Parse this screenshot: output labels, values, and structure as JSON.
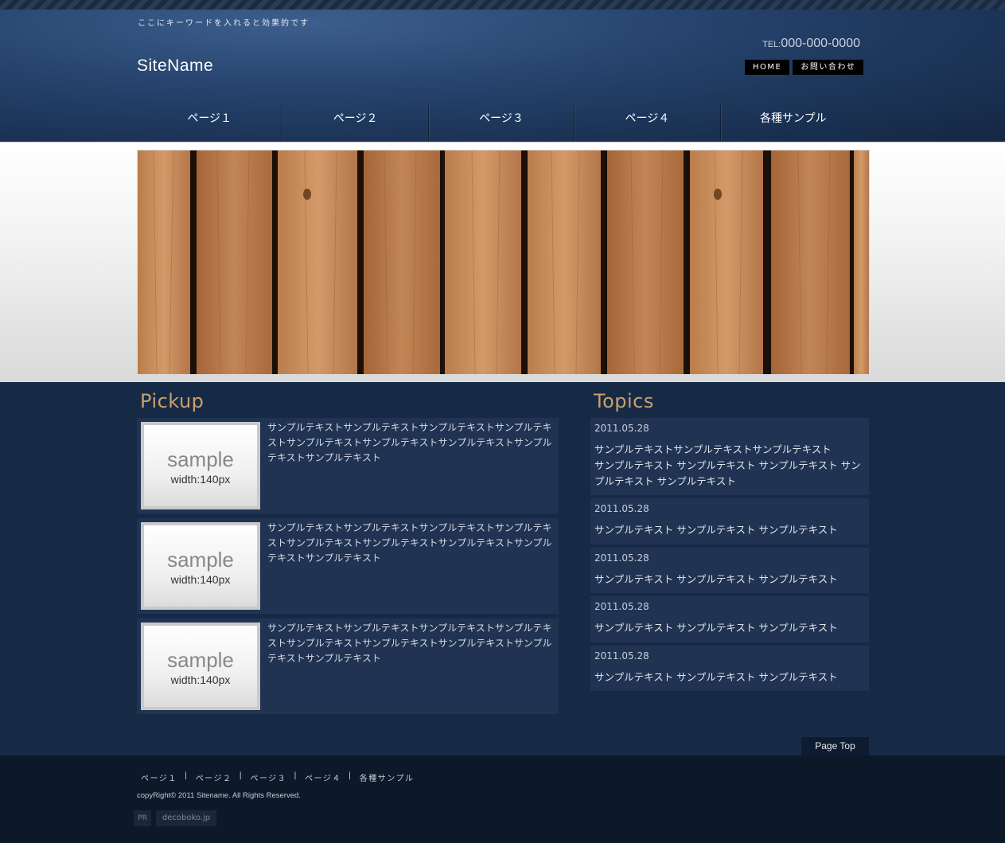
{
  "header": {
    "keyword": "ここにキーワードを入れると効果的です",
    "site_name": "SiteName",
    "tel_label": "TEL:",
    "tel_number": "000-000-0000",
    "home_button": "HOME",
    "contact_button": "お問い合わせ"
  },
  "nav": [
    "ページ１",
    "ページ２",
    "ページ３",
    "ページ４",
    "各種サンプル"
  ],
  "pickup": {
    "title": "Pickup",
    "items": [
      {
        "thumb_word": "sample",
        "thumb_size": "width:140px",
        "text": "サンプルテキストサンプルテキストサンプルテキストサンプルテキストサンプルテキストサンプルテキストサンプルテキストサンプルテキストサンプルテキスト"
      },
      {
        "thumb_word": "sample",
        "thumb_size": "width:140px",
        "text": "サンプルテキストサンプルテキストサンプルテキストサンプルテキストサンプルテキストサンプルテキストサンプルテキストサンプルテキストサンプルテキスト"
      },
      {
        "thumb_word": "sample",
        "thumb_size": "width:140px",
        "text": "サンプルテキストサンプルテキストサンプルテキストサンプルテキストサンプルテキストサンプルテキストサンプルテキストサンプルテキストサンプルテキスト"
      }
    ]
  },
  "topics": {
    "title": "Topics",
    "items": [
      {
        "date": "2011.05.28",
        "line1": "サンプルテキストサンプルテキストサンプルテキスト",
        "line2": "サンプルテキスト サンプルテキスト サンプルテキスト サンプルテキスト サンプルテキスト"
      },
      {
        "date": "2011.05.28",
        "line1": "サンプルテキスト サンプルテキスト サンプルテキスト",
        "line2": ""
      },
      {
        "date": "2011.05.28",
        "line1": "サンプルテキスト サンプルテキスト サンプルテキスト",
        "line2": ""
      },
      {
        "date": "2011.05.28",
        "line1": "サンプルテキスト サンプルテキスト サンプルテキスト",
        "line2": ""
      },
      {
        "date": "2011.05.28",
        "line1": "サンプルテキスト サンプルテキスト サンプルテキスト",
        "line2": ""
      }
    ]
  },
  "page_top": "Page Top",
  "footer": {
    "nav": [
      "ページ１",
      "ページ２",
      "ページ３",
      "ページ４",
      "各種サンプル"
    ],
    "separator": "|",
    "copyright": "copyRight© 2011 Sitename. All Rights Reserved.",
    "pr": "PR",
    "decoboko": "decoboko.jp"
  },
  "colors": {
    "background": "#172a45",
    "header": "#284671",
    "panel": "#203352",
    "section_title": "#caa06c",
    "footer": "#0d1829",
    "wood": "#b5794a"
  }
}
